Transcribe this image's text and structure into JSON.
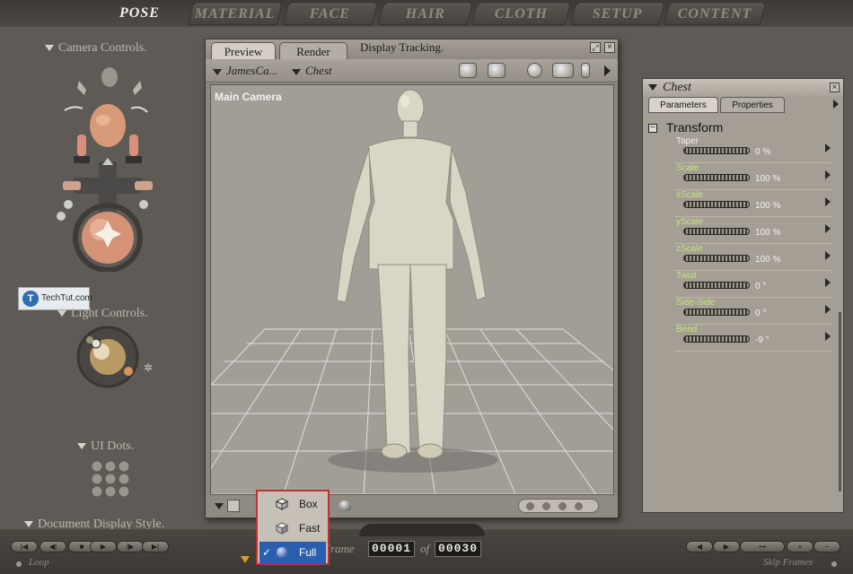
{
  "top_tabs": {
    "pose": "POSE",
    "material": "MATERIAL",
    "face": "FACE",
    "hair": "HAIR",
    "cloth": "CLOTH",
    "setup": "SETUP",
    "content": "CONTENT"
  },
  "left_panel": {
    "camera_controls_label": "Camera Controls.",
    "light_controls_label": "Light Controls.",
    "ui_dots_label": "UI Dots.",
    "document_display_style_label": "Document Display Style."
  },
  "watermark": {
    "brand": "TechTut.com"
  },
  "preview_window": {
    "tabs": [
      "Preview",
      "Render"
    ],
    "display_tracking_label": "Display Tracking.",
    "camera_select": "JamesCa...",
    "element_select": "Chest",
    "viewport_label": "Main Camera"
  },
  "parameters_panel": {
    "title": "Chest",
    "tabs": [
      "Parameters",
      "Properties"
    ],
    "group_title": "Transform",
    "params": [
      {
        "name": "Taper",
        "value": "0 %"
      },
      {
        "name": "Scale",
        "value": "100 %"
      },
      {
        "name": "xScale",
        "value": "100 %"
      },
      {
        "name": "yScale",
        "value": "100 %"
      },
      {
        "name": "zScale",
        "value": "100 %"
      },
      {
        "name": "Twist",
        "value": "0 °"
      },
      {
        "name": "Side-Side",
        "value": "0 °"
      },
      {
        "name": "Bend",
        "value": "-9 °"
      }
    ],
    "param_name_colors": {
      "normal": "#f2efe9",
      "scale": "#c6e57a"
    }
  },
  "display_style_menu": {
    "items": [
      "Box",
      "Fast",
      "Full"
    ],
    "selected": "Full",
    "check_mark": "✓"
  },
  "timeline": {
    "frame_label": "Frame",
    "current_frame": "00001",
    "of_label": "of",
    "total_frames": "00030",
    "loop_label": "Loop",
    "skip_frames_label": "Skip Frames"
  },
  "colors": {
    "accent_red_border": "#c23131",
    "menu_selection": "#2a5fb0",
    "figure": "#d9d6c5"
  }
}
